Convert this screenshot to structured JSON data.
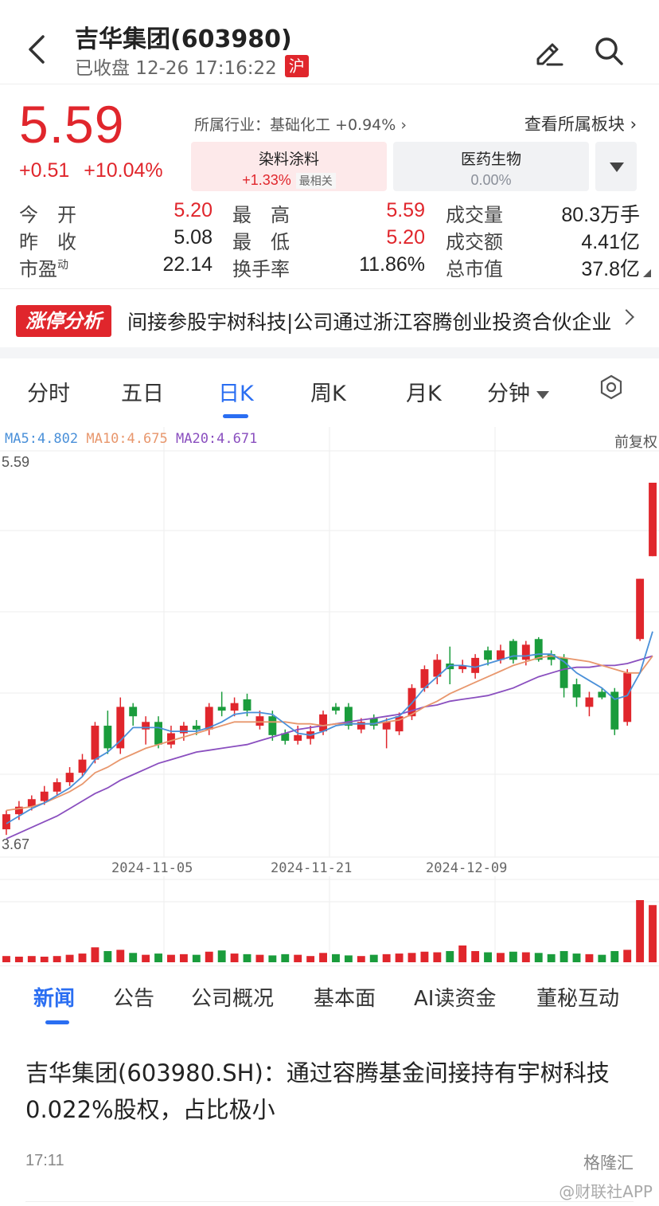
{
  "header": {
    "title": "吉华集团(603980)",
    "status": "已收盘 12-26 17:16:22",
    "exchange_badge": "沪"
  },
  "quote": {
    "price": "5.59",
    "change": "+0.51",
    "change_pct": "+10.04%",
    "industry": "所属行业：基础化工 +0.94%",
    "sector_link": "查看所属板块",
    "sectors": [
      {
        "name": "染料涂料",
        "change": "+1.33%",
        "tag": "最相关"
      },
      {
        "name": "医药生物",
        "change": "0.00%"
      }
    ]
  },
  "stats": {
    "open_label": "今　开",
    "open": "5.20",
    "high_label": "最　高",
    "high": "5.59",
    "volume_label": "成交量",
    "volume": "80.3万手",
    "prev_label": "昨　收",
    "prev": "5.08",
    "low_label": "最　低",
    "low": "5.20",
    "amount_label": "成交额",
    "amount": "4.41亿",
    "pe_label": "市盈",
    "pe_sup": "动",
    "pe": "22.14",
    "turnover_label": "换手率",
    "turnover": "11.86%",
    "mcap_label": "总市值",
    "mcap": "37.8亿"
  },
  "banner": {
    "tag": "涨停分析",
    "text": "间接参股宇树科技|公司通过浙江容腾创业投资合伙企业"
  },
  "chart_tabs": [
    "分时",
    "五日",
    "日K",
    "周K",
    "月K",
    "分钟"
  ],
  "colors": {
    "up": "#e0262c",
    "down": "#1a9c3c",
    "accent": "#2a6ef2"
  },
  "chart_data": {
    "type": "candlestick",
    "ma_labels": {
      "ma5": "MA5:4.802",
      "ma10": "MA10:4.675",
      "ma20": "MA20:4.671"
    },
    "adjust": "前复权",
    "y_max_label": "5.59",
    "y_min_label": "3.67",
    "ylim": [
      3.67,
      5.59
    ],
    "date_labels": [
      "2024-11-05",
      "2024-11-21",
      "2024-12-09"
    ],
    "candles": [
      [
        3.75,
        3.83,
        3.72,
        3.85
      ],
      [
        3.83,
        3.87,
        3.8,
        3.9
      ],
      [
        3.87,
        3.91,
        3.85,
        3.93
      ],
      [
        3.9,
        3.95,
        3.88,
        3.98
      ],
      [
        3.95,
        4.0,
        3.93,
        4.02
      ],
      [
        4.0,
        4.05,
        3.98,
        4.08
      ],
      [
        4.05,
        4.12,
        4.03,
        4.15
      ],
      [
        4.12,
        4.3,
        4.1,
        4.32
      ],
      [
        4.3,
        4.18,
        4.15,
        4.38
      ],
      [
        4.18,
        4.4,
        4.15,
        4.45
      ],
      [
        4.4,
        4.35,
        4.3,
        4.42
      ],
      [
        4.28,
        4.32,
        4.2,
        4.35
      ],
      [
        4.32,
        4.2,
        4.18,
        4.35
      ],
      [
        4.2,
        4.26,
        4.18,
        4.3
      ],
      [
        4.26,
        4.3,
        4.22,
        4.32
      ],
      [
        4.3,
        4.28,
        4.25,
        4.33
      ],
      [
        4.28,
        4.4,
        4.25,
        4.42
      ],
      [
        4.4,
        4.38,
        4.35,
        4.48
      ],
      [
        4.38,
        4.42,
        4.35,
        4.45
      ],
      [
        4.44,
        4.38,
        4.35,
        4.47
      ],
      [
        4.3,
        4.35,
        4.28,
        4.38
      ],
      [
        4.35,
        4.25,
        4.22,
        4.38
      ],
      [
        4.26,
        4.22,
        4.2,
        4.28
      ],
      [
        4.22,
        4.25,
        4.2,
        4.3
      ],
      [
        4.23,
        4.27,
        4.2,
        4.3
      ],
      [
        4.27,
        4.36,
        4.25,
        4.38
      ],
      [
        4.4,
        4.38,
        4.36,
        4.42
      ],
      [
        4.4,
        4.3,
        4.28,
        4.42
      ],
      [
        4.28,
        4.32,
        4.26,
        4.34
      ],
      [
        4.34,
        4.3,
        4.28,
        4.36
      ],
      [
        4.28,
        4.32,
        4.18,
        4.34
      ],
      [
        4.27,
        4.35,
        4.25,
        4.37
      ],
      [
        4.35,
        4.5,
        4.33,
        4.52
      ],
      [
        4.5,
        4.6,
        4.48,
        4.62
      ],
      [
        4.56,
        4.65,
        4.52,
        4.68
      ],
      [
        4.63,
        4.6,
        4.52,
        4.72
      ],
      [
        4.6,
        4.62,
        4.58,
        4.65
      ],
      [
        4.58,
        4.66,
        4.55,
        4.68
      ],
      [
        4.7,
        4.65,
        4.62,
        4.72
      ],
      [
        4.65,
        4.7,
        4.63,
        4.73
      ],
      [
        4.75,
        4.65,
        4.63,
        4.76
      ],
      [
        4.65,
        4.73,
        4.62,
        4.75
      ],
      [
        4.76,
        4.65,
        4.64,
        4.77
      ],
      [
        4.68,
        4.65,
        4.62,
        4.7
      ],
      [
        4.66,
        4.5,
        4.45,
        4.68
      ],
      [
        4.52,
        4.45,
        4.4,
        4.55
      ],
      [
        4.4,
        4.45,
        4.35,
        4.48
      ],
      [
        4.48,
        4.45,
        4.44,
        4.5
      ],
      [
        4.48,
        4.28,
        4.25,
        4.5
      ],
      [
        4.32,
        4.58,
        4.3,
        4.6
      ],
      [
        4.76,
        5.08,
        4.75,
        5.08
      ],
      [
        5.2,
        5.59,
        5.2,
        5.59
      ]
    ],
    "ma5": [
      3.78,
      3.82,
      3.86,
      3.89,
      3.93,
      3.97,
      4.03,
      4.12,
      4.16,
      4.22,
      4.29,
      4.29,
      4.29,
      4.27,
      4.27,
      4.27,
      4.29,
      4.32,
      4.36,
      4.37,
      4.37,
      4.36,
      4.31,
      4.26,
      4.25,
      4.27,
      4.3,
      4.31,
      4.31,
      4.31,
      4.33,
      4.35,
      4.42,
      4.5,
      4.56,
      4.62,
      4.62,
      4.61,
      4.63,
      4.65,
      4.67,
      4.67,
      4.68,
      4.68,
      4.64,
      4.58,
      4.54,
      4.5,
      4.44,
      4.46,
      4.58,
      4.8
    ],
    "ma10": [
      3.85,
      3.86,
      3.87,
      3.89,
      3.92,
      3.95,
      3.99,
      4.05,
      4.08,
      4.12,
      4.15,
      4.18,
      4.2,
      4.22,
      4.24,
      4.26,
      4.28,
      4.3,
      4.32,
      4.32,
      4.32,
      4.32,
      4.32,
      4.31,
      4.31,
      4.3,
      4.31,
      4.31,
      4.31,
      4.31,
      4.32,
      4.33,
      4.36,
      4.4,
      4.43,
      4.47,
      4.5,
      4.53,
      4.56,
      4.59,
      4.62,
      4.64,
      4.66,
      4.67,
      4.66,
      4.65,
      4.64,
      4.62,
      4.6,
      4.58,
      4.58,
      4.67
    ],
    "ma20": [
      3.7,
      3.73,
      3.76,
      3.79,
      3.82,
      3.86,
      3.9,
      3.94,
      3.97,
      4.01,
      4.04,
      4.07,
      4.1,
      4.12,
      4.14,
      4.16,
      4.17,
      4.18,
      4.19,
      4.2,
      4.22,
      4.24,
      4.26,
      4.28,
      4.29,
      4.3,
      4.31,
      4.32,
      4.33,
      4.34,
      4.35,
      4.36,
      4.38,
      4.4,
      4.41,
      4.43,
      4.44,
      4.45,
      4.46,
      4.48,
      4.5,
      4.53,
      4.56,
      4.58,
      4.6,
      4.61,
      4.61,
      4.62,
      4.62,
      4.63,
      4.65,
      4.67
    ],
    "volume": [
      0.1,
      0.09,
      0.1,
      0.09,
      0.1,
      0.12,
      0.14,
      0.24,
      0.18,
      0.2,
      0.15,
      0.12,
      0.14,
      0.12,
      0.13,
      0.12,
      0.17,
      0.19,
      0.14,
      0.13,
      0.12,
      0.11,
      0.13,
      0.12,
      0.1,
      0.15,
      0.13,
      0.11,
      0.1,
      0.12,
      0.13,
      0.14,
      0.15,
      0.17,
      0.16,
      0.18,
      0.27,
      0.18,
      0.16,
      0.15,
      0.17,
      0.16,
      0.15,
      0.13,
      0.18,
      0.14,
      0.13,
      0.12,
      0.18,
      0.2,
      1.0,
      0.92
    ]
  },
  "news_tabs": [
    "新闻",
    "公告",
    "公司概况",
    "基本面",
    "AI读资金",
    "董秘互动"
  ],
  "news": {
    "title": "吉华集团(603980.SH)：通过容腾基金间接持有宇树科技0.022%股权，占比极小",
    "time": "17:11",
    "source": "格隆汇"
  },
  "watermark": "@财联社APP"
}
